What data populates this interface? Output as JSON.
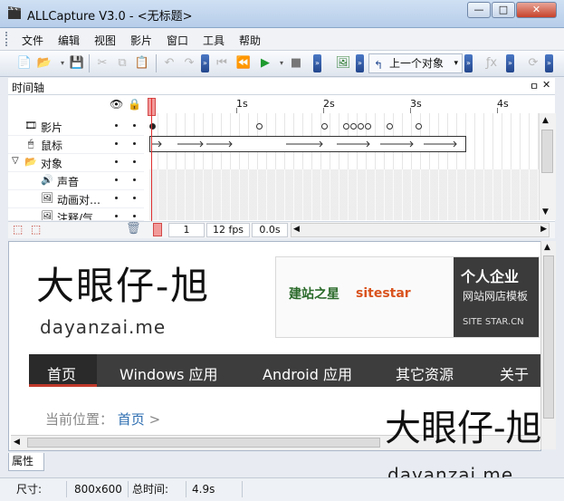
{
  "window": {
    "title": "ALLCapture V3.0 - <无标题>",
    "min_label": "—",
    "max_label": "□",
    "close_label": "✕"
  },
  "menu": [
    "文件",
    "编辑",
    "视图",
    "影片",
    "窗口",
    "工具",
    "帮助"
  ],
  "toolbar": {
    "prev_object_label": "上一个对象",
    "prev_object_arrow": "▾"
  },
  "timeline": {
    "panel_title": "时间轴",
    "pin_label": "ㅁ",
    "close_label": "✕",
    "ruler": [
      "1s",
      "2s",
      "3s",
      "4s"
    ],
    "rows": [
      {
        "label": "影片",
        "icon": "film-icon"
      },
      {
        "label": "鼠标",
        "icon": "mouse-icon"
      },
      {
        "label": "对象",
        "icon": "folder-icon"
      },
      {
        "label": "声音",
        "icon": "speaker-icon"
      },
      {
        "label": "动画对…",
        "icon": "image-icon"
      },
      {
        "label": "注释/气…",
        "icon": "image-icon"
      }
    ],
    "status": {
      "frame": "1",
      "fps": "12 fps",
      "time": "0.0s"
    }
  },
  "preview": {
    "logo_cn": "大眼仔-旭",
    "logo_en": "dayanzai.me",
    "banner_left": "建站之星",
    "banner_brand": "sitestar",
    "banner_right_title": "个人企业",
    "banner_right_sub": "网站网店模板",
    "banner_right_foot": "SITE STAR.CN",
    "nav": [
      "首页",
      "Windows 应用",
      "Android 应用",
      "其它资源",
      "关于"
    ],
    "breadcrumb_label": "当前位置：",
    "breadcrumb_link": "首页",
    "breadcrumb_sep": ">"
  },
  "watermark": {
    "cn": "大眼仔-旭",
    "en": "dayanzai.me"
  },
  "props_tab": "属性",
  "status": {
    "size_label": "尺寸:",
    "size_value": "800x600",
    "total_label": "总时间:",
    "total_value": "4.9s"
  }
}
